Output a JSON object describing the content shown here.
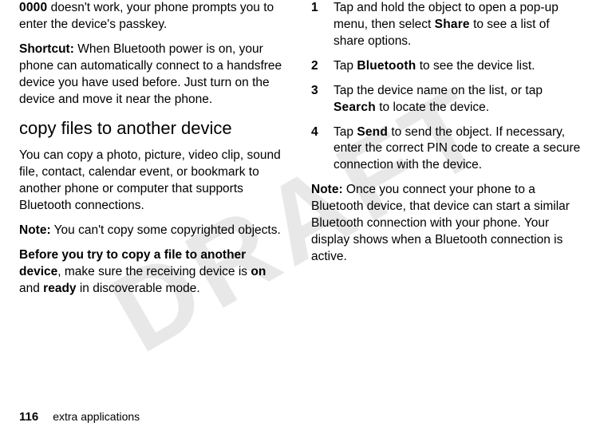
{
  "watermark": "DRAFT",
  "left": {
    "p1_pre": "0000",
    "p1_rest": " doesn't work, your phone prompts you to enter the device's passkey.",
    "p2_label": "Shortcut:",
    "p2_rest": " When Bluetooth power is on, your phone can automatically connect to a handsfree device you have used before. Just turn on the device and move it near the phone.",
    "heading": "copy files to another device",
    "p3": "You can copy a photo, picture, video clip, sound file, contact, calendar event, or bookmark to another phone or computer that supports Bluetooth connections.",
    "p4_label": "Note:",
    "p4_rest": " You can't copy some copyrighted objects.",
    "p5_label": "Before you try to copy a file to another device",
    "p5_mid": ", make sure the receiving device is ",
    "p5_on": "on",
    "p5_and": " and ",
    "p5_ready": "ready",
    "p5_end": " in discoverable mode."
  },
  "right": {
    "steps": {
      "s1_num": "1",
      "s1_a": "Tap and hold the object to open a pop-up menu, then select ",
      "s1_b": "Share",
      "s1_c": " to see a list of share options.",
      "s2_num": "2",
      "s2_a": "Tap ",
      "s2_b": "Bluetooth",
      "s2_c": " to see the device list.",
      "s3_num": "3",
      "s3_a": "Tap the device name on the list, or tap ",
      "s3_b": "Search",
      "s3_c": " to locate the device.",
      "s4_num": "4",
      "s4_a": "Tap ",
      "s4_b": "Send",
      "s4_c": " to send the object. If necessary, enter the correct PIN code to create a secure connection with the device."
    },
    "note_label": "Note:",
    "note_rest": " Once you connect your phone to a Bluetooth device, that device can start a similar Bluetooth connection with your phone. Your display shows when a Bluetooth connection is active."
  },
  "footer": {
    "page_num": "116",
    "section": "extra applications"
  }
}
